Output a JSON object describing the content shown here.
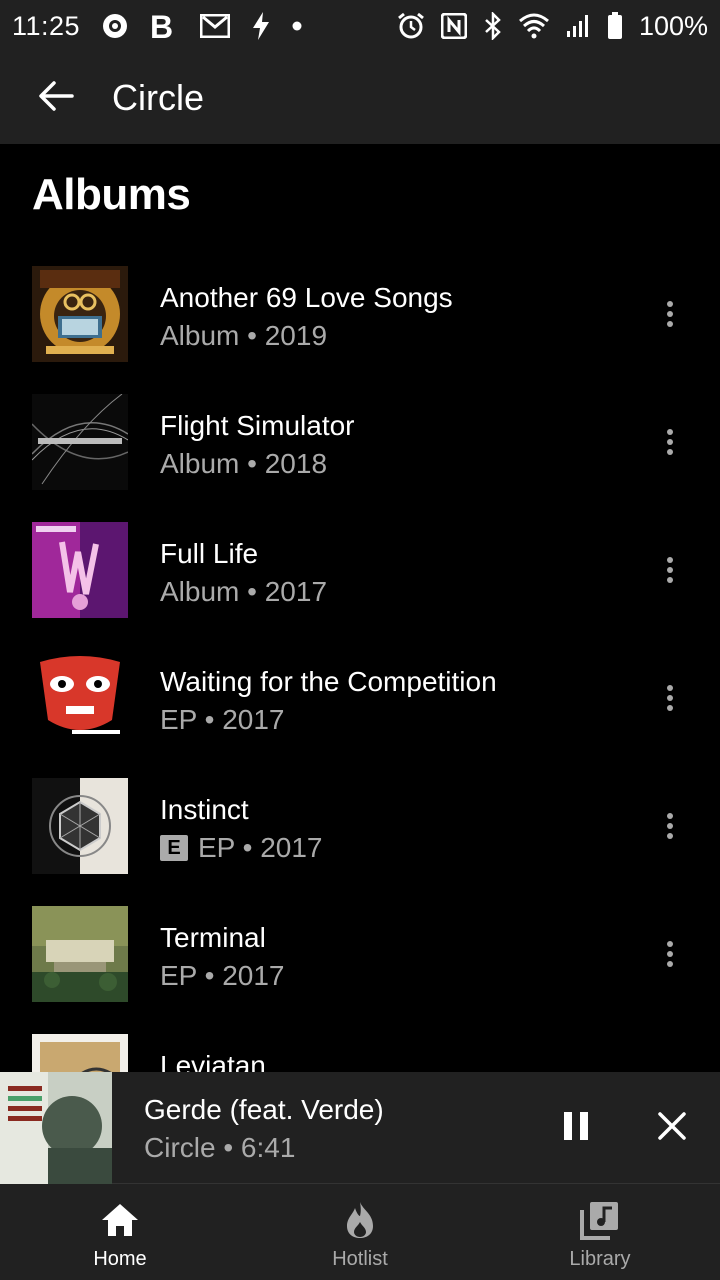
{
  "status_bar": {
    "time": "11:25",
    "battery_percent": "100%",
    "icons_left": [
      "media-play-icon",
      "b-app-icon",
      "gmail-icon",
      "flash-icon",
      "dot-icon"
    ],
    "icons_right": [
      "alarm-icon",
      "nfc-icon",
      "bluetooth-icon",
      "wifi-icon",
      "signal-icon",
      "battery-icon"
    ]
  },
  "app_bar": {
    "title": "Circle",
    "back_icon": "arrow-back-icon"
  },
  "section": {
    "title": "Albums"
  },
  "albums": [
    {
      "title": "Another 69 Love Songs",
      "type": "Album",
      "year": "2019",
      "explicit": false,
      "subtitle": "Album • 2019"
    },
    {
      "title": "Flight Simulator",
      "type": "Album",
      "year": "2018",
      "explicit": false,
      "subtitle": "Album • 2018"
    },
    {
      "title": "Full Life",
      "type": "Album",
      "year": "2017",
      "explicit": false,
      "subtitle": "Album • 2017"
    },
    {
      "title": "Waiting for the Competition",
      "type": "EP",
      "year": "2017",
      "explicit": false,
      "subtitle": "EP • 2017"
    },
    {
      "title": "Instinct",
      "type": "EP",
      "year": "2017",
      "explicit": true,
      "explicit_label": "E",
      "subtitle": "EP • 2017"
    },
    {
      "title": "Terminal",
      "type": "EP",
      "year": "2017",
      "explicit": false,
      "subtitle": "EP • 2017"
    },
    {
      "title": "Leviatan",
      "type": "",
      "year": "",
      "explicit": false,
      "subtitle": ""
    }
  ],
  "mini_player": {
    "title": "Gerde (feat. Verde)",
    "subtitle": "Circle • 6:41",
    "pause_icon": "pause-icon",
    "close_icon": "close-icon"
  },
  "bottom_nav": {
    "items": [
      {
        "label": "Home",
        "icon": "home-icon",
        "active": true
      },
      {
        "label": "Hotlist",
        "icon": "flame-icon",
        "active": false
      },
      {
        "label": "Library",
        "icon": "library-music-icon",
        "active": false
      }
    ]
  },
  "colors": {
    "bar_background": "#212121",
    "page_background": "#000000",
    "primary_text": "#ffffff",
    "secondary_text": "#aaaaaa"
  }
}
